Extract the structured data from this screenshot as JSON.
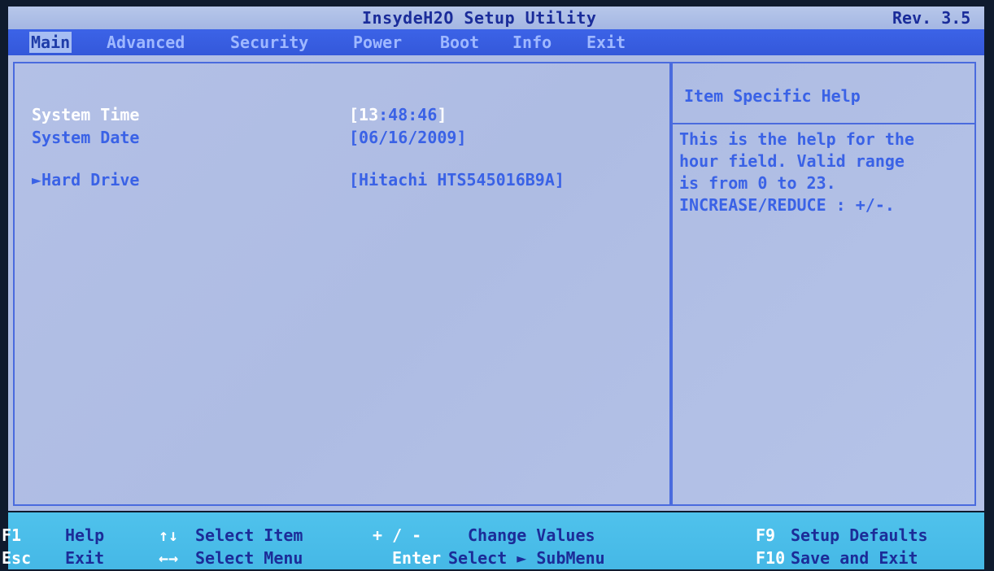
{
  "header": {
    "title": "InsydeH2O Setup Utility",
    "revision": "Rev. 3.5"
  },
  "menu": {
    "tabs": [
      {
        "label": "Main",
        "active": true
      },
      {
        "label": "Advanced",
        "active": false
      },
      {
        "label": "Security",
        "active": false
      },
      {
        "label": "Power",
        "active": false
      },
      {
        "label": "Boot",
        "active": false
      },
      {
        "label": "Info",
        "active": false
      },
      {
        "label": "Exit",
        "active": false
      }
    ]
  },
  "main": {
    "system_time": {
      "label": "System Time",
      "bracket_open": "[",
      "hour": "13",
      "rest": ":48:46",
      "bracket_close": "]"
    },
    "system_date": {
      "label": "System Date",
      "value": "[06/16/2009]"
    },
    "hard_drive": {
      "label": "►Hard Drive",
      "value": "[Hitachi HTS545016B9A]"
    }
  },
  "help": {
    "title": "Item Specific Help",
    "body": "This is the help for the\nhour field. Valid range\nis from 0 to 23.\nINCREASE/REDUCE : +/-."
  },
  "footer": {
    "items": [
      {
        "key": "F1",
        "desc": "Help"
      },
      {
        "key": "Esc",
        "desc": "Exit"
      },
      {
        "key": "↑↓",
        "desc": "Select Item"
      },
      {
        "key": "←→",
        "desc": "Select Menu"
      },
      {
        "key": "+ / -",
        "desc": "Change Values"
      },
      {
        "key": "Enter",
        "desc": "Select ► SubMenu"
      },
      {
        "key": "F9",
        "desc": "Setup Defaults"
      },
      {
        "key": "F10",
        "desc": "Save and Exit"
      }
    ]
  },
  "colors": {
    "menu_bar": "#3458da",
    "main_background": "#aebce3",
    "accent_text": "#3a62e6",
    "highlight_text": "#ffffff",
    "footer_background": "#45b8e6"
  }
}
